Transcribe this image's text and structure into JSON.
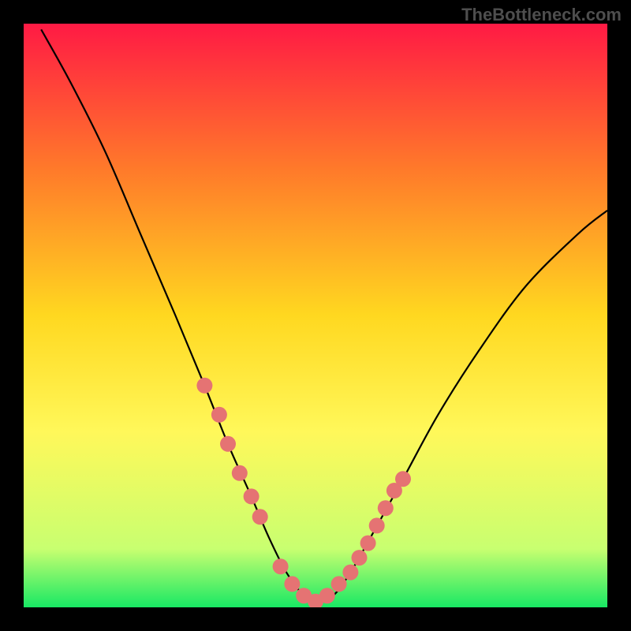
{
  "watermark": "TheBottleneck.com",
  "chart_data": {
    "type": "line",
    "title": "",
    "xlabel": "",
    "ylabel": "",
    "xlim": [
      0,
      100
    ],
    "ylim": [
      0,
      100
    ],
    "gradient_stops": [
      {
        "offset": 0,
        "color": "#ff1a44"
      },
      {
        "offset": 25,
        "color": "#ff7a2a"
      },
      {
        "offset": 50,
        "color": "#ffd820"
      },
      {
        "offset": 70,
        "color": "#fff85a"
      },
      {
        "offset": 90,
        "color": "#c8ff70"
      },
      {
        "offset": 100,
        "color": "#18e864"
      }
    ],
    "series": [
      {
        "name": "bottleneck-curve",
        "x": [
          3,
          8,
          14,
          20,
          26,
          31,
          35,
          39,
          42,
          45,
          48,
          50,
          53,
          56,
          60,
          65,
          71,
          78,
          86,
          95,
          100
        ],
        "y": [
          99,
          90,
          78,
          64,
          50,
          38,
          28,
          19,
          12,
          6,
          2,
          1,
          2,
          6,
          13,
          22,
          33,
          44,
          55,
          64,
          68
        ]
      }
    ],
    "markers": {
      "name": "highlight-points",
      "color": "#e57373",
      "radius": 10,
      "x": [
        31,
        33.5,
        35,
        37,
        39,
        40.5,
        44,
        46,
        48,
        50,
        52,
        54,
        56,
        57.5,
        59,
        60.5,
        62,
        63.5,
        65
      ],
      "y": [
        38,
        33,
        28,
        23,
        19,
        15.5,
        7,
        4,
        2,
        1,
        2,
        4,
        6,
        8.5,
        11,
        14,
        17,
        20,
        22
      ]
    }
  }
}
